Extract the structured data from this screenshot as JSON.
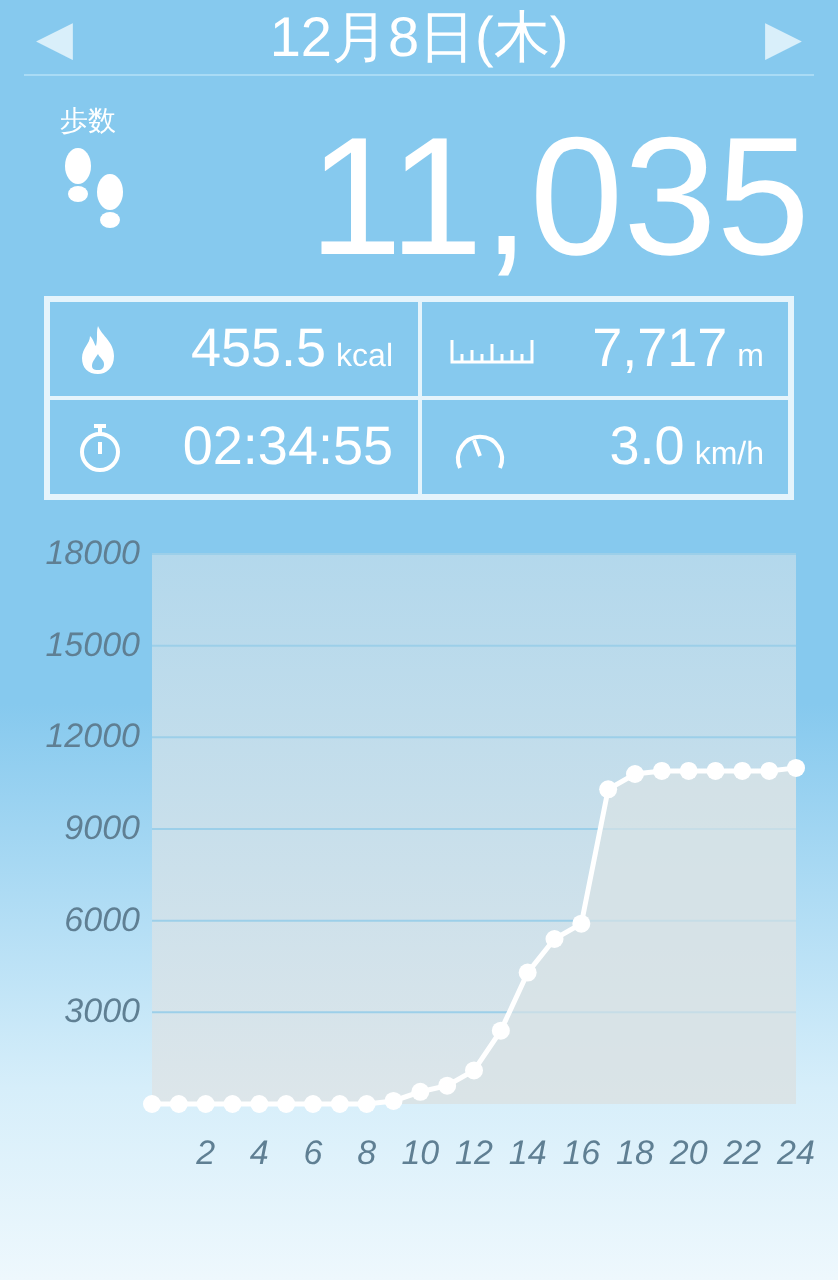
{
  "header": {
    "date": "12月8日(木)",
    "prev": "◀",
    "next": "▶"
  },
  "steps": {
    "label": "歩数",
    "value": "11,035"
  },
  "stats": [
    {
      "kind": "calories",
      "value": "455.5",
      "unit": "kcal"
    },
    {
      "kind": "distance",
      "value": "7,717",
      "unit": "m"
    },
    {
      "kind": "time",
      "value": "02:34:55"
    },
    {
      "kind": "speed",
      "value": "3.0",
      "unit": "km/h"
    }
  ],
  "chart": {
    "chart_data": {
      "type": "area",
      "x": [
        0,
        1,
        2,
        3,
        4,
        5,
        6,
        7,
        8,
        9,
        10,
        11,
        12,
        13,
        14,
        15,
        16,
        17,
        18,
        19,
        20,
        21,
        22,
        23,
        24
      ],
      "series": [
        {
          "color": "#ffffff",
          "values": [
            0,
            0,
            0,
            0,
            0,
            0,
            0,
            0,
            0,
            100,
            400,
            600,
            1100,
            2400,
            4300,
            5400,
            5900,
            10300,
            10800,
            10900,
            10900,
            10900,
            10900,
            10900,
            11000
          ]
        }
      ],
      "grid": true,
      "xlim": [
        0,
        24
      ],
      "ylim": [
        0,
        18000
      ],
      "xticks": [
        2,
        4,
        6,
        8,
        10,
        12,
        14,
        16,
        18,
        20,
        22,
        24
      ],
      "yticks": [
        3000,
        6000,
        9000,
        12000,
        15000,
        18000
      ]
    }
  }
}
